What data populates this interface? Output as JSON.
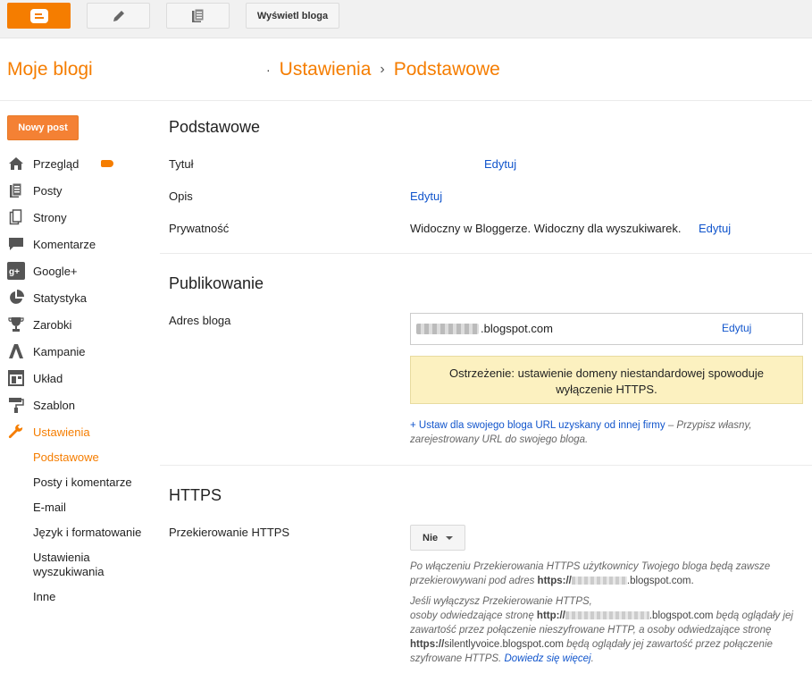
{
  "toolbar": {
    "view_blog": "Wyświetl bloga"
  },
  "header": {
    "brand": "Moje blogi",
    "crumb_dot": "·",
    "crumb1": "Ustawienia",
    "crumb_sep": "›",
    "crumb2": "Podstawowe"
  },
  "sidebar": {
    "new_post": "Nowy post",
    "items": [
      {
        "label": "Przegląd",
        "icon": "home-icon"
      },
      {
        "label": "Posty",
        "icon": "posts-icon"
      },
      {
        "label": "Strony",
        "icon": "pages-icon"
      },
      {
        "label": "Komentarze",
        "icon": "comment-icon"
      },
      {
        "label": "Google+",
        "icon": "google-plus-icon"
      },
      {
        "label": "Statystyka",
        "icon": "pie-chart-icon"
      },
      {
        "label": "Zarobki",
        "icon": "trophy-icon"
      },
      {
        "label": "Kampanie",
        "icon": "adwords-icon"
      },
      {
        "label": "Układ",
        "icon": "layout-icon"
      },
      {
        "label": "Szablon",
        "icon": "paint-roller-icon"
      },
      {
        "label": "Ustawienia",
        "icon": "wrench-icon"
      }
    ],
    "sub": [
      "Podstawowe",
      "Posty i komentarze",
      "E-mail",
      "Język i formatowanie",
      "Ustawienia wyszukiwania",
      "Inne"
    ]
  },
  "basic": {
    "title": "Podstawowe",
    "title_label": "Tytuł",
    "title_edit": "Edytuj",
    "desc_label": "Opis",
    "desc_edit": "Edytuj",
    "privacy_label": "Prywatność",
    "privacy_value": "Widoczny w Bloggerze. Widoczny dla wyszukiwarek.",
    "privacy_edit": "Edytuj"
  },
  "publish": {
    "title": "Publikowanie",
    "address_label": "Adres bloga",
    "address_suffix": ".blogspot.com",
    "address_edit": "Edytuj",
    "warning": "Ostrzeżenie: ustawienie domeny niestandardowej spowoduje wyłączenie HTTPS.",
    "custom_link": "+ Ustaw dla swojego bloga URL uzyskany od innej firmy",
    "custom_desc": " – Przypisz własny, zarejestrowany URL do swojego bloga."
  },
  "https": {
    "title": "HTTPS",
    "redirect_label": "Przekierowanie HTTPS",
    "redirect_value": "Nie",
    "note1_a": "Po włączeniu Przekierowania HTTPS użytkownicy Twojego bloga będą zawsze przekierowywani pod adres ",
    "note1_b": "https://",
    "note1_c": ".blogspot.com.",
    "note2_a": "Jeśli wyłączysz Przekierowanie HTTPS,",
    "note2_b": "osoby odwiedzające stronę ",
    "note2_c": "http://",
    "note2_d": ".blogspot.com",
    "note2_e": " będą oglądały jej zawartość przez połączenie nieszyfrowane HTTP, a osoby odwiedzające stronę ",
    "note2_f": "https://",
    "note2_g": "silentlyvoice.blogspot.com",
    "note2_h": " będą oglądały jej zawartość przez połączenie szyfrowane HTTPS. ",
    "note2_link": "Dowiedz się więcej",
    "note2_end": "."
  }
}
